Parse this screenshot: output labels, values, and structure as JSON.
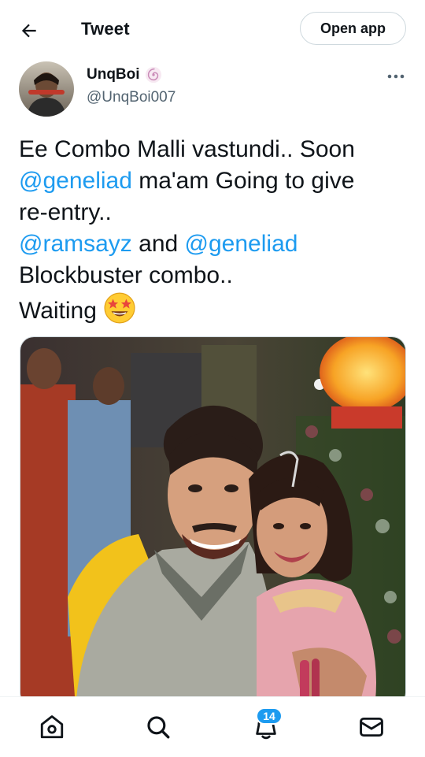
{
  "header": {
    "title": "Tweet",
    "open_app_label": "Open app",
    "back_icon": "arrow-left-icon"
  },
  "author": {
    "name": "UnqBoi",
    "handle": "@UnqBoi007",
    "badge_icon": "spiral-badge-icon",
    "more_icon": "more-horizontal-icon"
  },
  "tweet": {
    "line1": "Ee Combo Malli vastundi.. Soon",
    "mention1": "@geneliad",
    "line2_rest": " ma'am Going to give",
    "line3": "re-entry..",
    "mention2": "@ramsayz",
    "line4_mid": " and ",
    "mention3": "@geneliad",
    "line5": "Blockbuster combo..",
    "line6": "Waiting",
    "emoji": "star-struck-emoji"
  },
  "bottom_nav": {
    "items": [
      "home-icon",
      "search-icon",
      "notifications-icon",
      "messages-icon"
    ],
    "notifications_count": "14"
  },
  "colors": {
    "accent": "#1d9bf0",
    "text": "#0f1419",
    "secondary": "#536471",
    "border": "#cfd9de"
  }
}
